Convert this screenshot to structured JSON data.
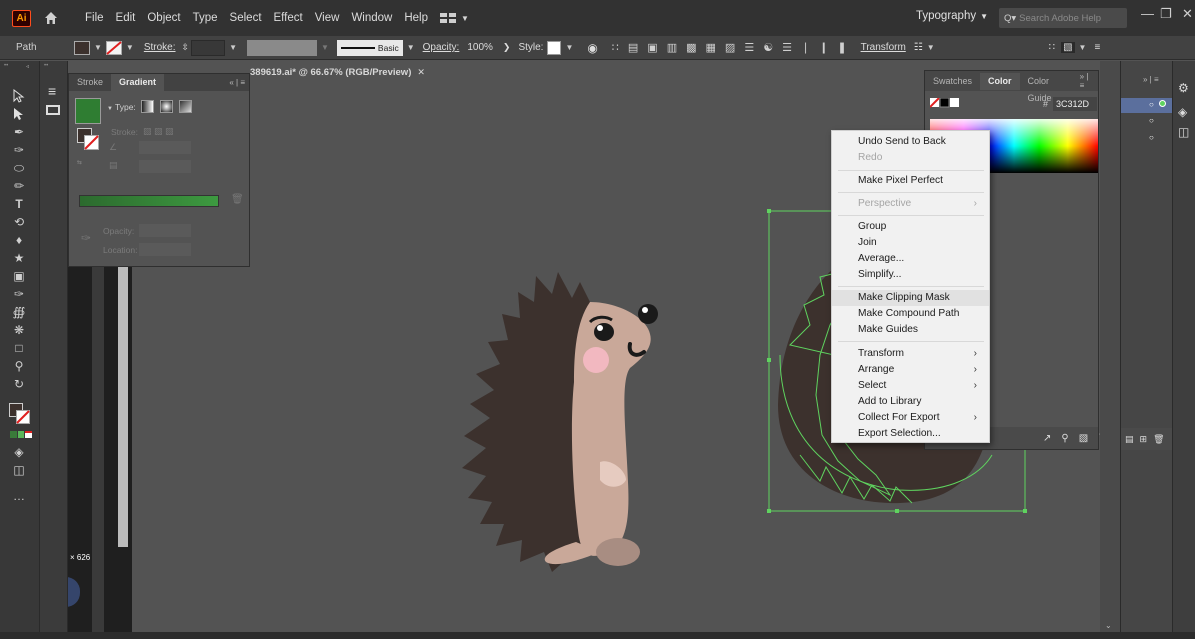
{
  "menubar": {
    "app_logo": "Ai",
    "items": [
      "File",
      "Edit",
      "Object",
      "Type",
      "Select",
      "Effect",
      "View",
      "Window",
      "Help"
    ],
    "workspace": "Typography",
    "search_placeholder": "Search Adobe Help"
  },
  "controlbar": {
    "selection_type": "Path",
    "stroke_label": "Stroke:",
    "brush_label": "Basic",
    "opacity_label": "Opacity:",
    "opacity_value": "100%",
    "style_label": "Style:",
    "transform_label": "Transform"
  },
  "gradient_panel": {
    "tabs": [
      "Stroke",
      "Gradient"
    ],
    "type_label": "Type:",
    "stroke_label": "Stroke:",
    "opacity_label": "Opacity:",
    "location_label": "Location:"
  },
  "document": {
    "tab_title": "389619.ai* @ 66.67% (RGB/Preview)",
    "size_readout": "× 626"
  },
  "color_panel": {
    "tabs": [
      "Swatches",
      "Color",
      "Color Guide"
    ],
    "hex_value": "3C312D"
  },
  "context_menu": {
    "items": [
      {
        "label": "Undo Send to Back",
        "disabled": false
      },
      {
        "label": "Redo",
        "disabled": true
      },
      {
        "label": "Make Pixel Perfect",
        "disabled": false
      },
      {
        "label": "Perspective",
        "disabled": true,
        "submenu": true
      },
      {
        "label": "Group",
        "disabled": false
      },
      {
        "label": "Join",
        "disabled": false
      },
      {
        "label": "Average...",
        "disabled": false
      },
      {
        "label": "Simplify...",
        "disabled": false
      },
      {
        "label": "Make Clipping Mask",
        "disabled": false,
        "highlighted": true
      },
      {
        "label": "Make Compound Path",
        "disabled": false
      },
      {
        "label": "Make Guides",
        "disabled": false
      },
      {
        "label": "Transform",
        "disabled": false,
        "submenu": true
      },
      {
        "label": "Arrange",
        "disabled": false,
        "submenu": true
      },
      {
        "label": "Select",
        "disabled": false,
        "submenu": true
      },
      {
        "label": "Add to Library",
        "disabled": false
      },
      {
        "label": "Collect For Export",
        "disabled": false,
        "submenu": true
      },
      {
        "label": "Export Selection...",
        "disabled": false
      }
    ]
  },
  "colors": {
    "hedgehog_spikes": "#3c312d",
    "hedgehog_body": "#c9a899",
    "cheek": "#f2b8c0",
    "selection": "#5fd35f",
    "gradient_green": "#2f7d32"
  }
}
